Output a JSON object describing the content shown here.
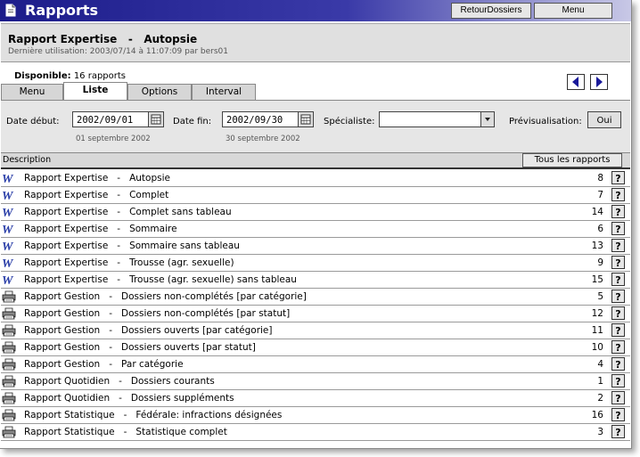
{
  "app": {
    "title": "Rapports"
  },
  "titlebar": {
    "retour_label": "RetourDossiers",
    "menu_label": "Menu"
  },
  "header": {
    "title": "Rapport Expertise   -   Autopsie",
    "subtitle": "Dernière utilisation: 2003/07/14 à 11:07:09 par bers01"
  },
  "availability": {
    "label": "Disponible:",
    "value": "16 rapports"
  },
  "tabs": [
    {
      "label": "Menu"
    },
    {
      "label": "Liste"
    },
    {
      "label": "Options"
    },
    {
      "label": "Interval"
    }
  ],
  "active_tab": "Liste",
  "filter": {
    "start_label": "Date début:",
    "start_value": "2002/09/01",
    "start_sub": "01 septembre 2002",
    "end_label": "Date fin:",
    "end_value": "2002/09/30",
    "end_sub": "30 septembre 2002",
    "specialist_label": "Spécialiste:",
    "specialist_value": "",
    "preview_label": "Prévisualisation:",
    "preview_button": "Oui"
  },
  "list": {
    "header": "Description",
    "all_button": "Tous les rapports",
    "help_glyph": "?",
    "rows": [
      {
        "icon": "word-icon",
        "text": "Rapport Expertise   -   Autopsie",
        "count": "8"
      },
      {
        "icon": "word-icon",
        "text": "Rapport Expertise   -   Complet",
        "count": "7"
      },
      {
        "icon": "word-icon",
        "text": "Rapport Expertise   -   Complet sans tableau",
        "count": "14"
      },
      {
        "icon": "word-icon",
        "text": "Rapport Expertise   -   Sommaire",
        "count": "6"
      },
      {
        "icon": "word-icon",
        "text": "Rapport Expertise   -   Sommaire sans tableau",
        "count": "13"
      },
      {
        "icon": "word-icon",
        "text": "Rapport Expertise   -   Trousse (agr. sexuelle)",
        "count": "9"
      },
      {
        "icon": "word-icon",
        "text": "Rapport Expertise   -   Trousse (agr. sexuelle) sans tableau",
        "count": "15"
      },
      {
        "icon": "printer-icon",
        "text": "Rapport Gestion   -   Dossiers non-complétés [par catégorie]",
        "count": "5"
      },
      {
        "icon": "printer-icon",
        "text": "Rapport Gestion   -   Dossiers non-complétés [par statut]",
        "count": "12"
      },
      {
        "icon": "printer-icon",
        "text": "Rapport Gestion   -   Dossiers ouverts [par catégorie]",
        "count": "11"
      },
      {
        "icon": "printer-icon",
        "text": "Rapport Gestion   -   Dossiers ouverts [par statut]",
        "count": "10"
      },
      {
        "icon": "printer-icon",
        "text": "Rapport Gestion   -   Par catégorie",
        "count": "4"
      },
      {
        "icon": "printer-icon",
        "text": "Rapport Quotidien   -   Dossiers courants",
        "count": "1"
      },
      {
        "icon": "printer-icon",
        "text": "Rapport Quotidien   -   Dossiers suppléments",
        "count": "2"
      },
      {
        "icon": "printer-icon",
        "text": "Rapport Statistique   -   Fédérale: infractions désignées",
        "count": "16"
      },
      {
        "icon": "printer-icon",
        "text": "Rapport Statistique   -   Statistique complet",
        "count": "3"
      }
    ]
  },
  "colors": {
    "titlebar_dark": "#1c1c8a",
    "panel_gray": "#e0e0e0",
    "word_blue": "#2b3fa8"
  }
}
